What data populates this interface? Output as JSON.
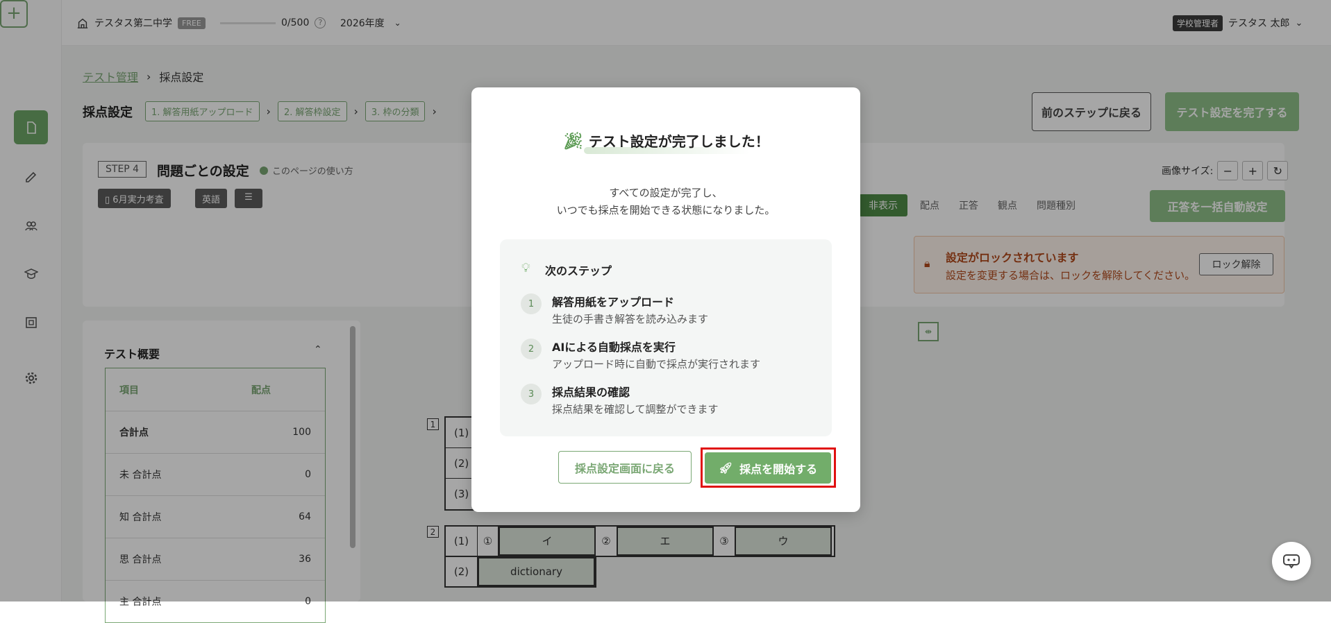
{
  "topbar": {
    "school": "テスタス第二中学",
    "plan": "FREE",
    "usage": "0/500",
    "year": "2026年度",
    "role": "学校管理者",
    "user": "テスタス 太郎"
  },
  "breadcrumb": {
    "root": "テスト管理",
    "current": "採点設定"
  },
  "steps": {
    "title": "採点設定",
    "items": [
      "1. 解答用紙アップロード",
      "2. 解答枠設定",
      "3. 枠の分類"
    ]
  },
  "actions": {
    "prev_step": "前のステップに戻る",
    "finish": "テスト設定を完了する"
  },
  "step4": {
    "badge": "STEP 4",
    "title": "問題ごとの設定",
    "howto": "このページの使い方",
    "tags": [
      "6月実力考査",
      "英語"
    ]
  },
  "image_size": {
    "label": "画像サイズ:",
    "minus": "−",
    "plus": "+"
  },
  "toggles": [
    "非表示",
    "配点",
    "正答",
    "観点",
    "問題種別"
  ],
  "auto_button": "正答を一括自動設定",
  "lock": {
    "title": "設定がロックされています",
    "subtitle": "設定を変更する場合は、ロックを解除してください。",
    "button": "ロック解除"
  },
  "summary": {
    "title": "テスト概要",
    "headers": [
      "項目",
      "配点"
    ],
    "rows": [
      {
        "label": "合計点",
        "value": "100"
      },
      {
        "label": "未 合計点",
        "value": "0"
      },
      {
        "label": "知 合計点",
        "value": "64"
      },
      {
        "label": "思 合計点",
        "value": "36"
      },
      {
        "label": "主 合計点",
        "value": "0"
      }
    ]
  },
  "answer_sheet": {
    "q1_label": "1",
    "q1_rows": [
      "(1)",
      "(2)",
      "(3)"
    ],
    "q2_label": "2",
    "q2_rows": [
      "(1)",
      "(2)"
    ],
    "q2_circles": [
      "①",
      "②",
      "③"
    ],
    "q2_answers": [
      "イ",
      "エ",
      "ウ"
    ],
    "q2_2_answer": "dictionary"
  },
  "modal": {
    "title": "テスト設定が完了しました！",
    "desc_line1": "すべての設定が完了し、",
    "desc_line2": "いつでも採点を開始できる状態になりました。",
    "next_label": "次のステップ",
    "steps": [
      {
        "num": "1",
        "title": "解答用紙をアップロード",
        "desc": "生徒の手書き解答を読み込みます"
      },
      {
        "num": "2",
        "title": "AIによる自動採点を実行",
        "desc": "アップロード時に自動で採点が実行されます"
      },
      {
        "num": "3",
        "title": "採点結果の確認",
        "desc": "採点結果を確認して調整ができます"
      }
    ],
    "back_button": "採点設定画面に戻る",
    "start_button": "採点を開始する"
  },
  "colors": {
    "accent": "#72ad6a",
    "highlight": "#e01010",
    "lock": "#b34a1c"
  }
}
